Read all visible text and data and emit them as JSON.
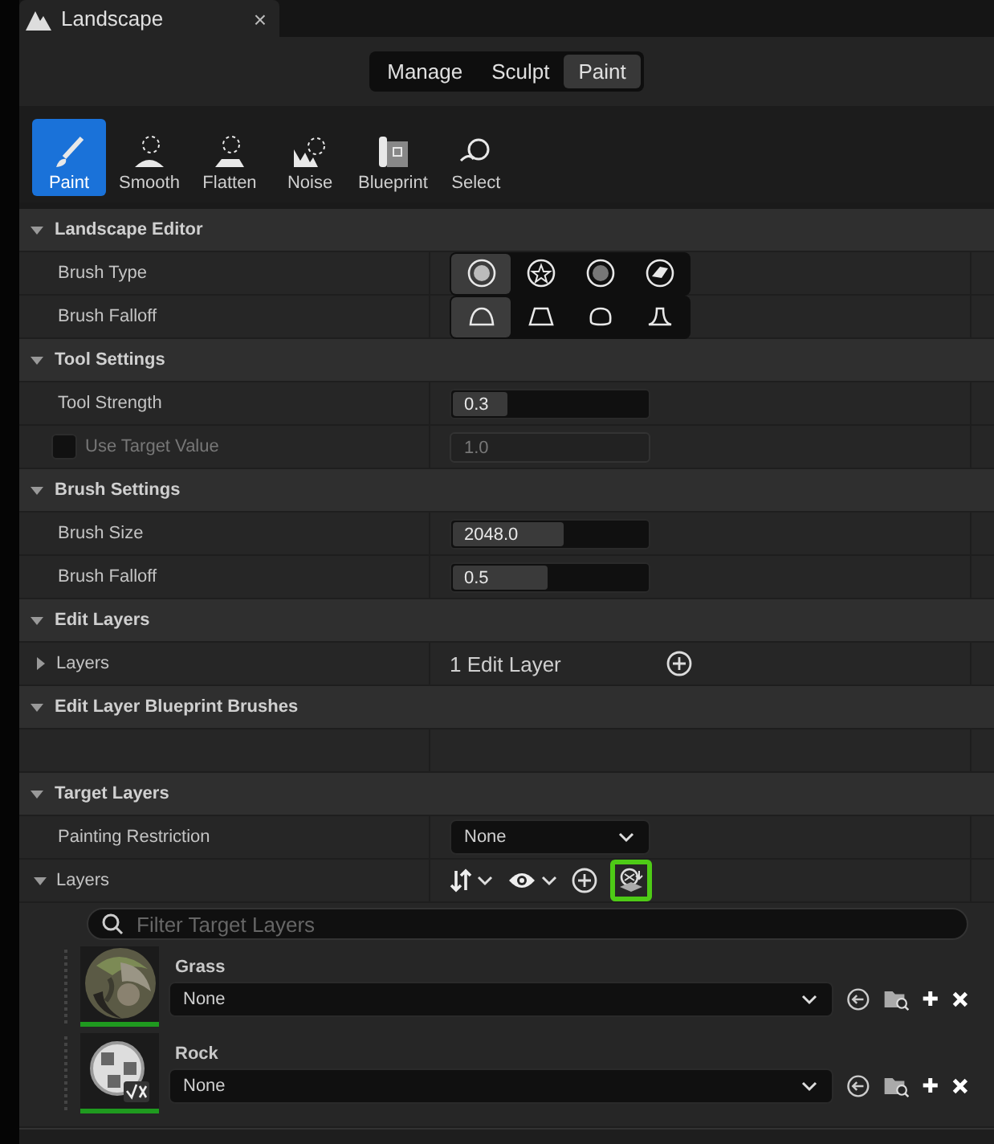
{
  "tab": {
    "title": "Landscape",
    "close": "×"
  },
  "modes": [
    {
      "label": "Manage",
      "selected": false
    },
    {
      "label": "Sculpt",
      "selected": false
    },
    {
      "label": "Paint",
      "selected": true
    }
  ],
  "tools": [
    {
      "label": "Paint",
      "selected": true
    },
    {
      "label": "Smooth",
      "selected": false
    },
    {
      "label": "Flatten",
      "selected": false
    },
    {
      "label": "Noise",
      "selected": false
    },
    {
      "label": "Blueprint",
      "selected": false
    },
    {
      "label": "Select",
      "selected": false
    }
  ],
  "sections": [
    {
      "title": "Landscape Editor",
      "expanded": true,
      "rows": [
        {
          "kind": "icons",
          "label": "Brush Type",
          "options": [
            {
              "selected": true
            },
            {
              "selected": false
            },
            {
              "selected": false
            },
            {
              "selected": false
            }
          ]
        },
        {
          "kind": "falloff",
          "label": "Brush Falloff",
          "options": [
            {
              "selected": true
            },
            {
              "selected": false
            },
            {
              "selected": false
            },
            {
              "selected": false
            }
          ]
        }
      ]
    },
    {
      "title": "Tool Settings",
      "expanded": true,
      "rows": [
        {
          "kind": "slider",
          "label": "Tool Strength",
          "value": "0.3",
          "level": 0.28
        },
        {
          "kind": "checkbox",
          "label": "Use Target Value",
          "checked": false,
          "disabled": true,
          "value": "1.0"
        }
      ]
    },
    {
      "title": "Brush Settings",
      "expanded": true,
      "rows": [
        {
          "kind": "slider",
          "label": "Brush Size",
          "value": "2048.0",
          "level": 0.56
        },
        {
          "kind": "slider",
          "label": "Brush Falloff",
          "value": "0.5",
          "level": 0.48
        }
      ]
    },
    {
      "title": "Edit Layers",
      "expanded": true,
      "rows": [
        {
          "kind": "count",
          "label": "Layers",
          "expanded": false,
          "value": "1 Edit Layer"
        }
      ]
    },
    {
      "title": "Edit Layer Blueprint Brushes",
      "expanded": true,
      "rows": [
        {
          "kind": "empty"
        }
      ]
    },
    {
      "title": "Target Layers",
      "expanded": true,
      "rows": [
        {
          "kind": "dropdown",
          "label": "Painting Restriction",
          "value": "None"
        },
        {
          "kind": "toolbar",
          "label": "Layers",
          "expanded": true,
          "highlighted": true
        }
      ]
    }
  ],
  "filter": {
    "placeholder": "Filter Target Layers"
  },
  "layers": [
    {
      "name": "Grass",
      "value": "None",
      "kind": "picture"
    },
    {
      "name": "Rock",
      "value": "None",
      "kind": "checker"
    }
  ]
}
